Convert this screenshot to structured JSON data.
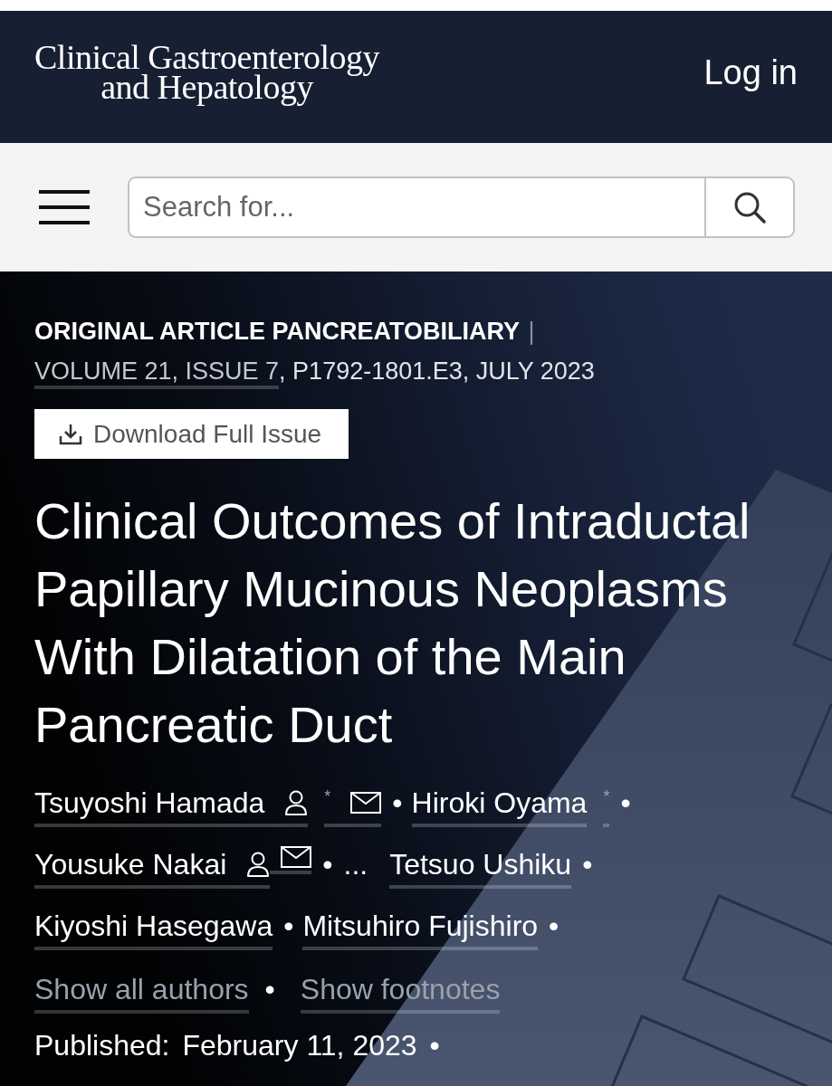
{
  "header": {
    "logo": [
      "Clinical Gastroenterology",
      "and Hepatology"
    ],
    "login": "Log in"
  },
  "search": {
    "placeholder": "Search for..."
  },
  "article": {
    "meta": {
      "article_type": "ORIGINAL ARTICLE PANCREATOBILIARY",
      "separator": "|",
      "issue_link": "VOLUME 21, ISSUE 7",
      "details": ", P1792-1801.E3, JULY 2023"
    },
    "download_button": "Download Full Issue",
    "title": "Clinical Outcomes of Intraductal Papillary Mucinous Neoplasms With Dilatation of the Main Pancreatic Duct",
    "authors": [
      {
        "kind": "author",
        "name": "Tsuyoshi Hamada",
        "profile": true,
        "footnote": "*",
        "email": true,
        "separator": "•"
      },
      {
        "kind": "author",
        "name": "Hiroki Oyama",
        "profile": false,
        "footnote": "*",
        "email": false,
        "separator": "•"
      },
      {
        "kind": "author",
        "name": "Yousuke Nakai",
        "profile": true,
        "email": true,
        "separator": "•"
      },
      {
        "kind": "ellipsis",
        "text": "..."
      },
      {
        "kind": "author",
        "name": "Tetsuo Ushiku",
        "profile": false,
        "email": false,
        "separator": "•"
      },
      {
        "kind": "author",
        "name": "Kiyoshi Hasegawa",
        "profile": false,
        "email": false,
        "separator": "•"
      },
      {
        "kind": "author",
        "name": "Mitsuhiro Fujishiro",
        "profile": false,
        "email": false,
        "separator": "•"
      }
    ],
    "show_all_authors": {
      "label": "Show all authors",
      "separator": "•"
    },
    "show_footnotes": "Show footnotes",
    "published": {
      "label": "Published:",
      "date": "February 11, 2023",
      "separator": "•"
    }
  }
}
